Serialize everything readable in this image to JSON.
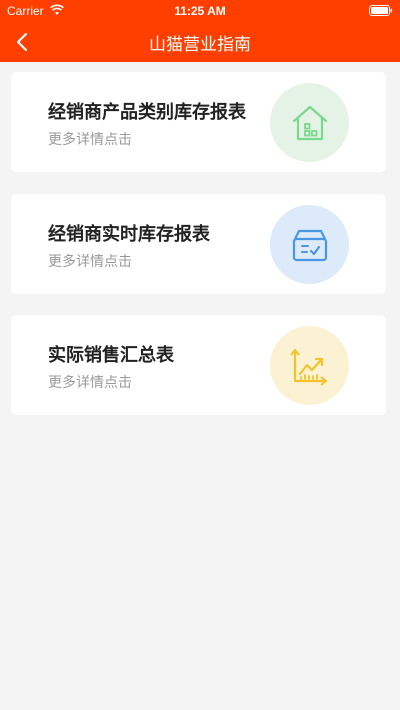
{
  "status_bar": {
    "carrier": "Carrier",
    "time": "11:25 AM"
  },
  "navbar": {
    "title": "山猫营业指南"
  },
  "cards": [
    {
      "title": "经销商产品类别库存报表",
      "subtitle": "更多详情点击",
      "icon": "house-icon",
      "icon_color": "#7bd88f",
      "bg_color": "#e4f3e6"
    },
    {
      "title": "经销商实时库存报表",
      "subtitle": "更多详情点击",
      "icon": "inbox-check-icon",
      "icon_color": "#4a97e3",
      "bg_color": "#dceafa"
    },
    {
      "title": "实际销售汇总表",
      "subtitle": "更多详情点击",
      "icon": "trend-chart-icon",
      "icon_color": "#f4c32a",
      "bg_color": "#fbf2d4"
    }
  ],
  "colors": {
    "header": "#ff3f00",
    "background": "#f4f4f4"
  }
}
